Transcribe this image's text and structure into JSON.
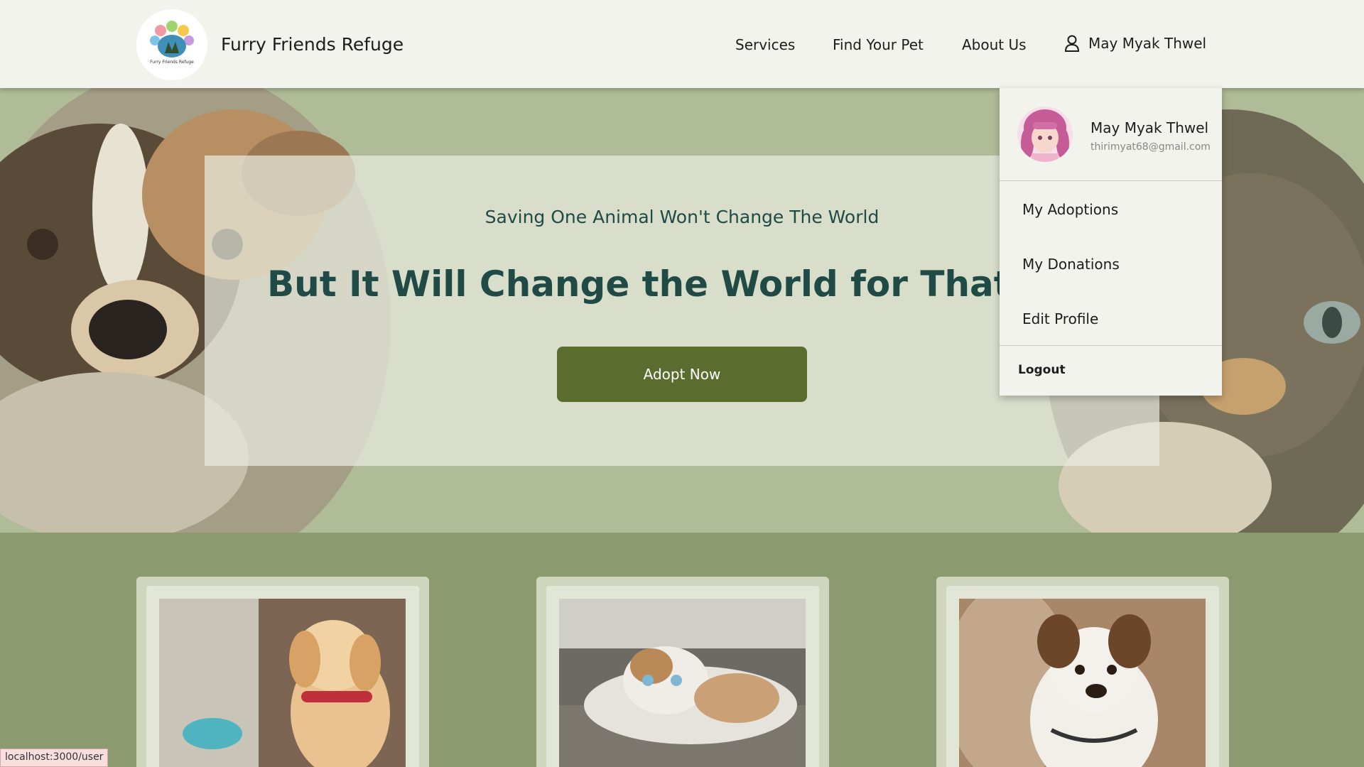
{
  "header": {
    "brand": "Furry Friends Refuge",
    "logo_text": "Furry Friends Refuge",
    "nav": [
      "Services",
      "Find Your Pet",
      "About Us"
    ],
    "user_name": "May Myak Thwel"
  },
  "hero": {
    "subtitle": "Saving One Animal Won't Change The World",
    "title": "But It Will Change the World for That One A",
    "button": "Adopt Now"
  },
  "dropdown": {
    "name": "May Myak Thwel",
    "email": "thirimyat68@gmail.com",
    "items": [
      "My Adoptions",
      "My Donations",
      "Edit Profile"
    ],
    "logout": "Logout"
  },
  "pet_cards": [
    {
      "icon": "puppy-photo"
    },
    {
      "icon": "cat-photo"
    },
    {
      "icon": "dog-photo"
    }
  ],
  "status_url": "localhost:3000/user",
  "colors": {
    "header_bg": "#f2f3ec",
    "hero_bg": "#b0bb97",
    "page_bg": "#8c9a70",
    "title_text": "#1f4a45",
    "button_bg": "#5b6c2f"
  }
}
